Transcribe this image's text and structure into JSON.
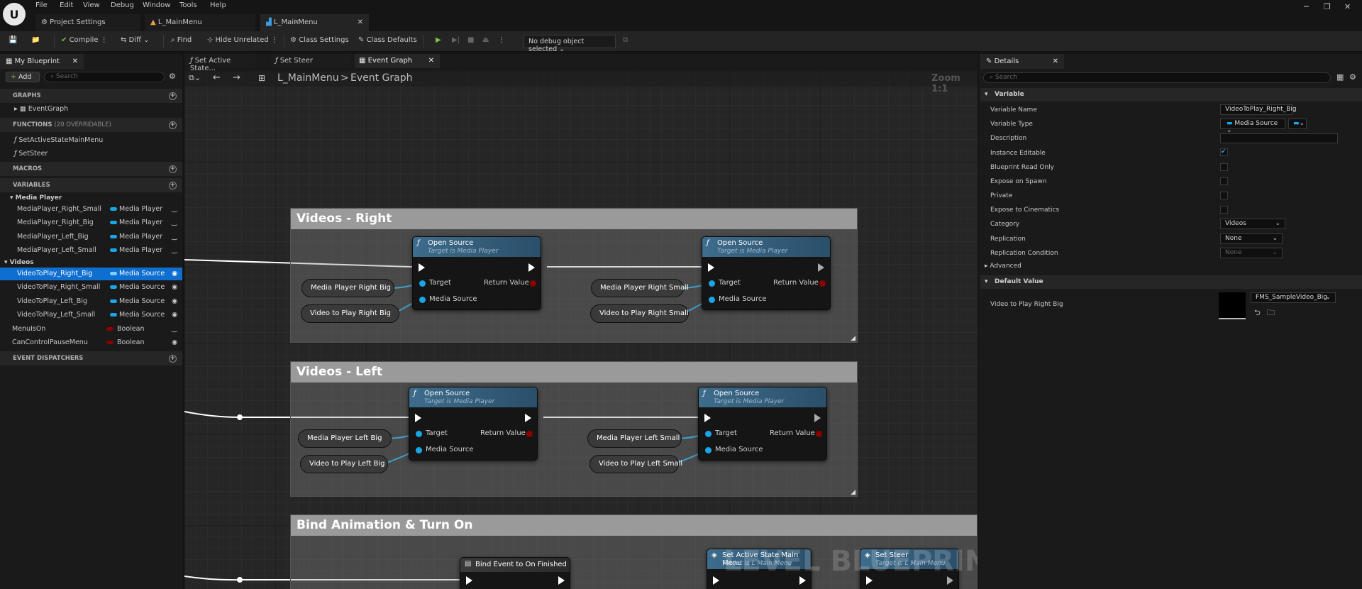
{
  "menu": {
    "items": [
      "File",
      "Edit",
      "View",
      "Debug",
      "Window",
      "Tools",
      "Help"
    ]
  },
  "tabs": [
    {
      "label": "Project Settings"
    },
    {
      "label": "L_MainMenu"
    },
    {
      "label": "L_MainMenu"
    }
  ],
  "toolbar": {
    "compile": "Compile",
    "diff": "Diff",
    "find": "Find",
    "hide_unrelated": "Hide Unrelated",
    "class_settings": "Class Settings",
    "class_defaults": "Class Defaults",
    "debug_object": "No debug object selected"
  },
  "left_panel": {
    "tab": "My Blueprint",
    "add": "Add",
    "search_placeholder": "Search",
    "sections": {
      "graphs": "GRAPHS",
      "functions": "FUNCTIONS",
      "functions_count": "(20 OVERRIDABLE)",
      "macros": "MACROS",
      "variables": "VARIABLES",
      "dispatchers": "EVENT DISPATCHERS"
    },
    "graphs": [
      "EventGraph"
    ],
    "functions": [
      "SetActiveStateMainMenu",
      "SetSteer"
    ],
    "categories": {
      "media_player": "Media Player",
      "videos": "Videos"
    },
    "media_vars": [
      {
        "name": "MediaPlayer_Right_Small",
        "type": "Media Player"
      },
      {
        "name": "MediaPlayer_Right_Big",
        "type": "Media Player"
      },
      {
        "name": "MediaPlayer_Left_Big",
        "type": "Media Player"
      },
      {
        "name": "MediaPlayer_Left_Small",
        "type": "Media Player"
      }
    ],
    "video_vars": [
      {
        "name": "VideoToPlay_Right_Big",
        "type": "Media Source"
      },
      {
        "name": "VideoToPlay_Right_Small",
        "type": "Media Source"
      },
      {
        "name": "VideoToPlay_Left_Big",
        "type": "Media Source"
      },
      {
        "name": "VideoToPlay_Left_Small",
        "type": "Media Source"
      }
    ],
    "bool_vars": [
      {
        "name": "MenuIsOn",
        "type": "Boolean"
      },
      {
        "name": "CanControlPauseMenu",
        "type": "Boolean"
      }
    ]
  },
  "graph_tabs": [
    "Set Active State...",
    "Set Steer",
    "Event Graph"
  ],
  "breadcrumb": {
    "root": "L_MainMenu",
    "sep": ">",
    "current": "Event Graph"
  },
  "zoom": "Zoom 1:1",
  "watermark": "LEVEL BLUEPRINT",
  "comments": [
    {
      "title": "Videos - Right"
    },
    {
      "title": "Videos - Left"
    },
    {
      "title": "Bind Animation & Turn On"
    }
  ],
  "nodes": {
    "open_source": "Open Source",
    "target_sub": "Target is Media Player",
    "target": "Target",
    "media_source": "Media Source",
    "return_value": "Return Value",
    "bind_event": "Bind Event to On Finished",
    "set_active": "Set Active State Main Menu",
    "set_active_sub": "Target is L Main Menu",
    "set_steer": "Set Steer",
    "set_steer_sub": "Target is L Main Menu"
  },
  "var_nodes": {
    "r1": "Media Player Right Big",
    "r2": "Video to Play Right Big",
    "r3": "Media Player Right Small",
    "r4": "Video to Play Right Small",
    "l1": "Media Player Left Big",
    "l2": "Video to Play Left Big",
    "l3": "Media Player Left Small",
    "l4": "Video to Play Left Small"
  },
  "details": {
    "tab": "Details",
    "search_placeholder": "Search",
    "variable_section": "Variable",
    "rows": {
      "var_name_label": "Variable Name",
      "var_name": "VideoToPlay_Right_Big",
      "var_type_label": "Variable Type",
      "var_type": "Media Source",
      "description": "Description",
      "instance_editable": "Instance Editable",
      "read_only": "Blueprint Read Only",
      "expose_spawn": "Expose on Spawn",
      "private": "Private",
      "expose_cine": "Expose to Cinematics",
      "category_label": "Category",
      "category": "Videos",
      "replication_label": "Replication",
      "replication": "None",
      "rep_cond_label": "Replication Condition",
      "rep_cond": "None",
      "advanced": "Advanced"
    },
    "default_section": "Default Value",
    "default_label": "Video to Play Right Big",
    "default_asset": "FMS_SampleVideo_Big"
  },
  "colors": {
    "media_player": "#1aa6e6",
    "media_source": "#1aa6e6",
    "boolean": "#8c0000",
    "selected": "#0e6fd0"
  }
}
